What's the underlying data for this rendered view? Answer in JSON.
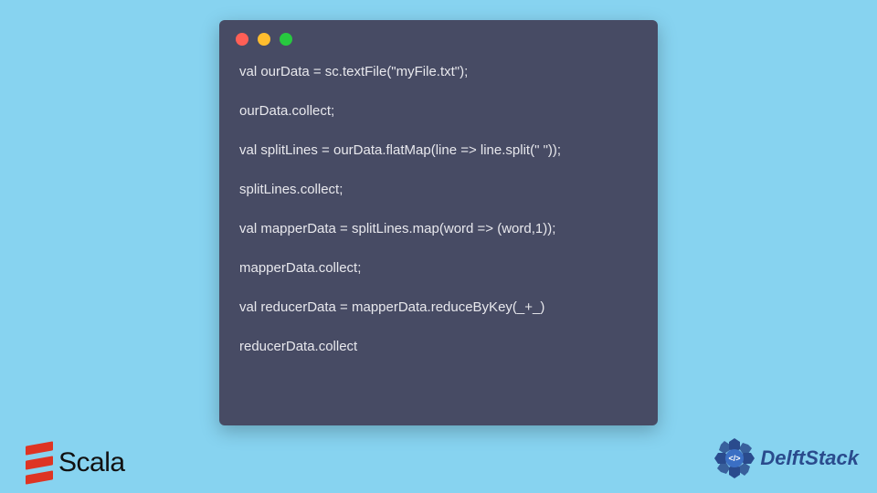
{
  "code": {
    "lines": [
      "val ourData = sc.textFile(\"myFile.txt\");",
      "ourData.collect;",
      "val splitLines = ourData.flatMap(line => line.split(\" \"));",
      "splitLines.collect;",
      "val mapperData = splitLines.map(word => (word,1));",
      "mapperData.collect;",
      "val reducerData = mapperData.reduceByKey(_+_)",
      "reducerData.collect"
    ]
  },
  "logos": {
    "scala_text": "Scala",
    "delft_text": "DelftStack"
  }
}
